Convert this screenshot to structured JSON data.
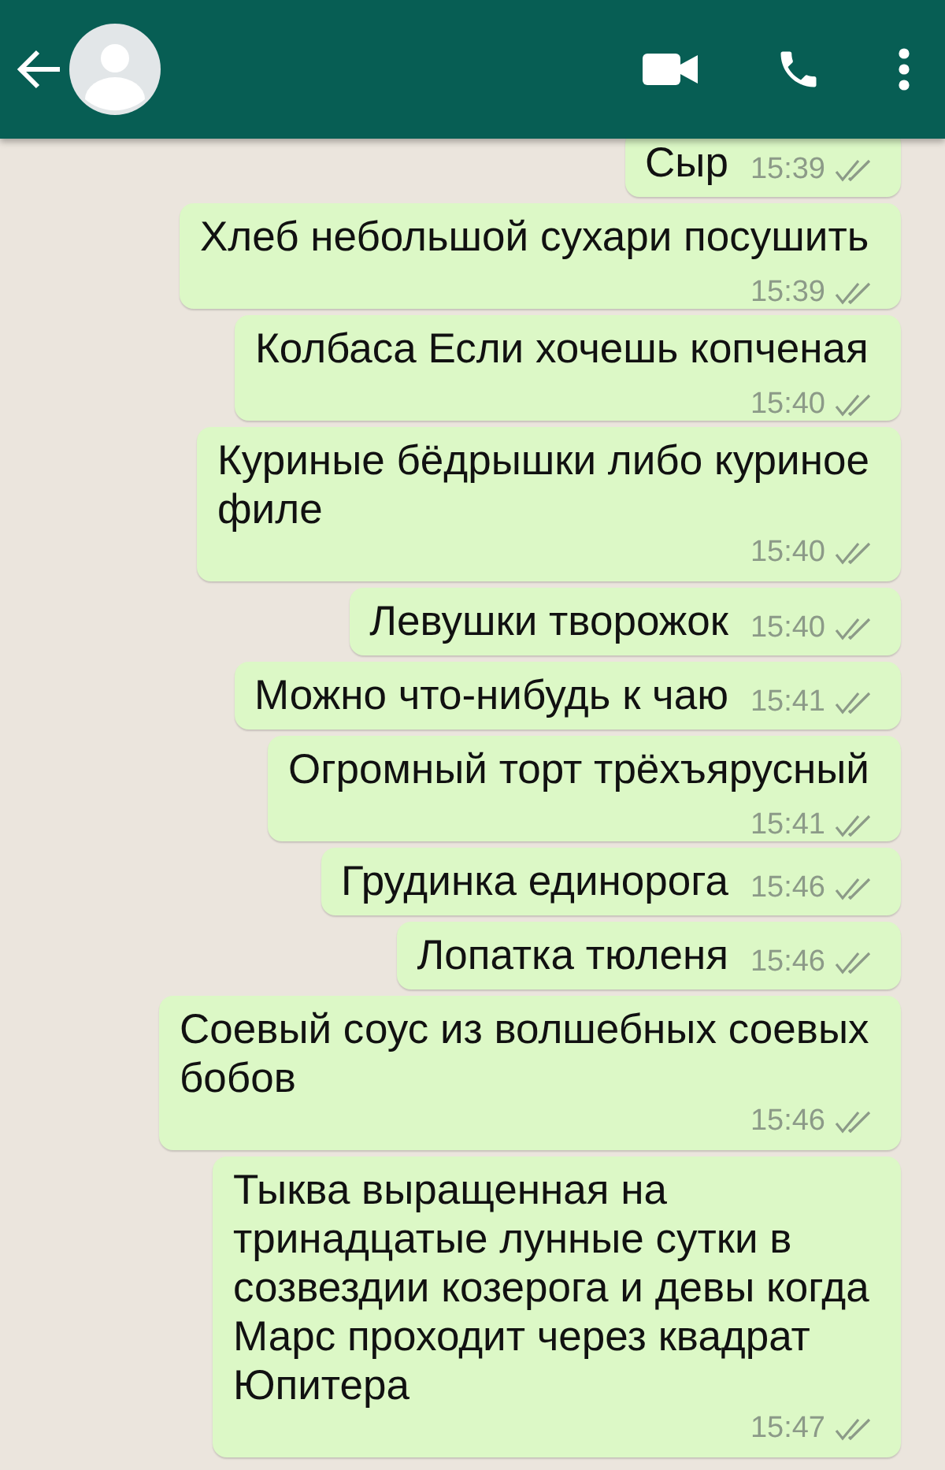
{
  "messages": [
    {
      "text": "Сыр",
      "time": "15:39"
    },
    {
      "text": "Хлеб небольшой сухари посушить",
      "time": "15:39"
    },
    {
      "text": "Колбаса Если хочешь копченая",
      "time": "15:40"
    },
    {
      "text": "Куриные бёдрышки либо куриное филе",
      "time": "15:40"
    },
    {
      "text": "Левушки творожок",
      "time": "15:40"
    },
    {
      "text": "Можно что-нибудь к чаю",
      "time": "15:41"
    },
    {
      "text": "Огромный торт трёхъярусный",
      "time": "15:41"
    },
    {
      "text": "Грудинка единорога",
      "time": "15:46"
    },
    {
      "text": "Лопатка тюленя",
      "time": "15:46"
    },
    {
      "text": "Соевый соус из волшебных соевых бобов",
      "time": "15:46"
    },
    {
      "text": "Тыква выращенная на тринадцатые лунные сутки в созвездии козерога и девы когда Марс проходит через квадрат Юпитера",
      "time": "15:47"
    }
  ]
}
